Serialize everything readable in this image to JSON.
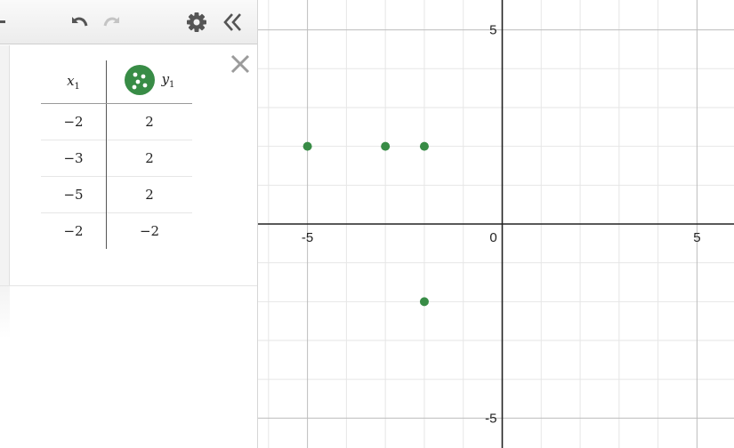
{
  "toolbar": {
    "icons": [
      "undo-icon",
      "redo-icon",
      "gear-icon",
      "collapse-panel-icon"
    ]
  },
  "table": {
    "header_x": "x",
    "header_x_sub": "1",
    "header_y": "y",
    "header_y_sub": "1",
    "rows": [
      {
        "x": "−2",
        "y": "2"
      },
      {
        "x": "−3",
        "y": "2"
      },
      {
        "x": "−5",
        "y": "2"
      },
      {
        "x": "−2",
        "y": "−2"
      }
    ],
    "point_color": "#388c46"
  },
  "graph": {
    "x_ticks": [
      {
        "value": -5,
        "label": "-5"
      },
      {
        "value": 0,
        "label": "0"
      },
      {
        "value": 5,
        "label": "5"
      }
    ],
    "y_ticks": [
      {
        "value": 5,
        "label": "5"
      },
      {
        "value": -5,
        "label": "-5"
      }
    ],
    "xlim": [
      -6.27,
      5.95
    ],
    "ylim": [
      -5.77,
      5.77
    ],
    "grid": true
  },
  "chart_data": {
    "type": "scatter",
    "title": "",
    "xlabel": "",
    "ylabel": "",
    "xlim": [
      -6.27,
      5.95
    ],
    "ylim": [
      -5.77,
      5.77
    ],
    "series": [
      {
        "x": [
          -2,
          -3,
          -5,
          -2
        ],
        "y": [
          2,
          2,
          2,
          -2
        ],
        "color": "#388c46"
      }
    ]
  }
}
